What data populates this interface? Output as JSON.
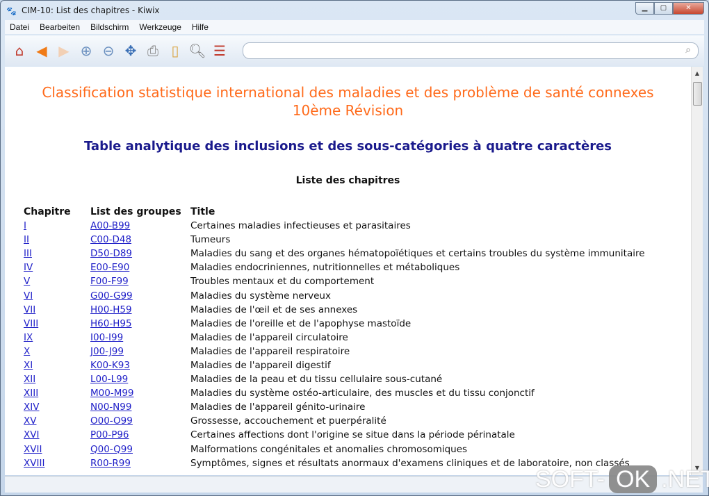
{
  "window": {
    "title": "CIM-10: List des chapitres - Kiwix"
  },
  "menu": [
    {
      "first": "D",
      "rest": "atei"
    },
    {
      "first": "Bear",
      "u": "b",
      "rest": "eiten"
    },
    {
      "first": "B",
      "rest": "ildschirm"
    },
    {
      "first": "W",
      "rest": "erkzeuge"
    },
    {
      "first": "H",
      "rest": "ilfe"
    }
  ],
  "menu_labels": [
    "Datei",
    "Bearbeiten",
    "Bildschirm",
    "Werkzeuge",
    "Hilfe"
  ],
  "toolbar": {
    "icons": [
      "home-icon",
      "back-icon",
      "forward-icon",
      "zoom-in-icon",
      "zoom-out-icon",
      "fit-icon",
      "print-icon",
      "bookmark-icon",
      "find-icon",
      "library-icon"
    ],
    "search_value": ""
  },
  "page": {
    "title_line1": "Classification statistique international des maladies et des problème de santé connexes",
    "title_line2": "10ème Révision",
    "subtitle": "Table analytique des inclusions et des sous-catégories à quatre caractères",
    "list_heading": "Liste des chapitres",
    "columns": [
      "Chapitre",
      "List des groupes",
      "Title"
    ],
    "rows": [
      [
        "I",
        "A00-B99",
        "Certaines maladies infectieuses et parasitaires"
      ],
      [
        "II",
        "C00-D48",
        "Tumeurs"
      ],
      [
        "III",
        "D50-D89",
        "Maladies du sang et des organes hématopoïétiques et certains troubles du système immunitaire"
      ],
      [
        "IV",
        "E00-E90",
        "Maladies endocriniennes, nutritionnelles et métaboliques"
      ],
      [
        "V",
        "F00-F99",
        "Troubles mentaux et du comportement"
      ],
      [
        "VI",
        "G00-G99",
        "Maladies du système nerveux"
      ],
      [
        "VII",
        "H00-H59",
        "Maladies de l'œil et de ses annexes"
      ],
      [
        "VIII",
        "H60-H95",
        "Maladies de l'oreille et de l'apophyse mastoïde"
      ],
      [
        "IX",
        "I00-I99",
        "Maladies de l'appareil circulatoire"
      ],
      [
        "X",
        "J00-J99",
        "Maladies de l'appareil respiratoire"
      ],
      [
        "XI",
        "K00-K93",
        "Maladies de l'appareil digestif"
      ],
      [
        "XII",
        "L00-L99",
        "Maladies de la peau et du tissu cellulaire sous-cutané"
      ],
      [
        "XIII",
        "M00-M99",
        "Maladies du système ostéo-articulaire, des muscles et du tissu conjonctif"
      ],
      [
        "XIV",
        "N00-N99",
        "Maladies de l'appareil génito-urinaire"
      ],
      [
        "XV",
        "O00-O99",
        "Grossesse, accouchement et puerpéralité"
      ],
      [
        "XVI",
        "P00-P96",
        "Certaines affections dont l'origine se situe dans la période périnatale"
      ],
      [
        "XVII",
        "Q00-Q99",
        "Malformations congénitales et anomalies chromosomiques"
      ],
      [
        "XVIII",
        "R00-R99",
        "Symptômes, signes et résultats anormaux d'examens cliniques et de laboratoire, non classés"
      ]
    ]
  },
  "watermark": "SOFT-OK.NET",
  "colors": {
    "title": "#ff6a1a",
    "subtitle": "#1a1a8c",
    "link": "#1f1fc8"
  }
}
